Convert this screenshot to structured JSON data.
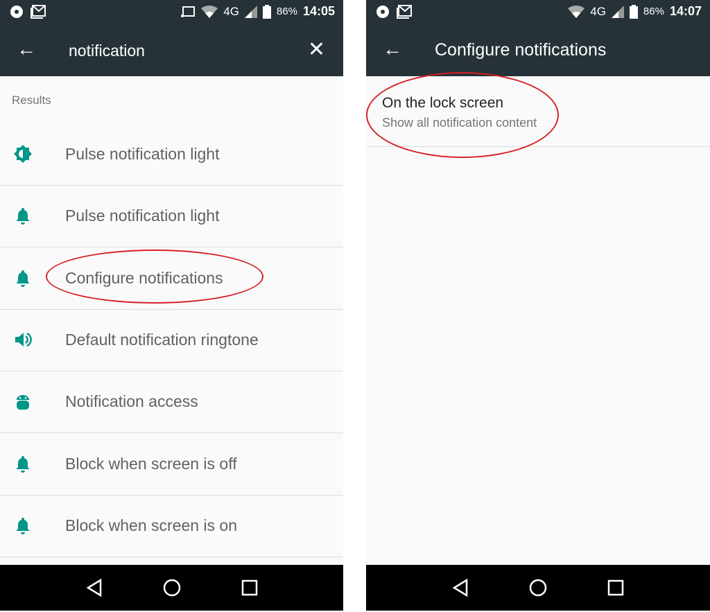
{
  "left": {
    "status": {
      "battery": "86%",
      "time": "14:05"
    },
    "search": {
      "query": "notification"
    },
    "results_label": "Results",
    "items": [
      {
        "label": "Pulse notification light",
        "icon": "brightness-icon"
      },
      {
        "label": "Pulse notification light",
        "icon": "bell-icon"
      },
      {
        "label": "Configure notifications",
        "icon": "bell-icon"
      },
      {
        "label": "Default notification ringtone",
        "icon": "volume-icon"
      },
      {
        "label": "Notification access",
        "icon": "android-icon"
      },
      {
        "label": "Block when screen is off",
        "icon": "bell-icon"
      },
      {
        "label": "Block when screen is on",
        "icon": "bell-icon"
      }
    ]
  },
  "right": {
    "status": {
      "battery": "86%",
      "time": "14:07"
    },
    "title": "Configure notifications",
    "setting": {
      "title": "On the lock screen",
      "summary": "Show all notification content"
    }
  },
  "colors": {
    "toolbar": "#263238",
    "accent": "#009688",
    "annotation": "#d62027"
  }
}
